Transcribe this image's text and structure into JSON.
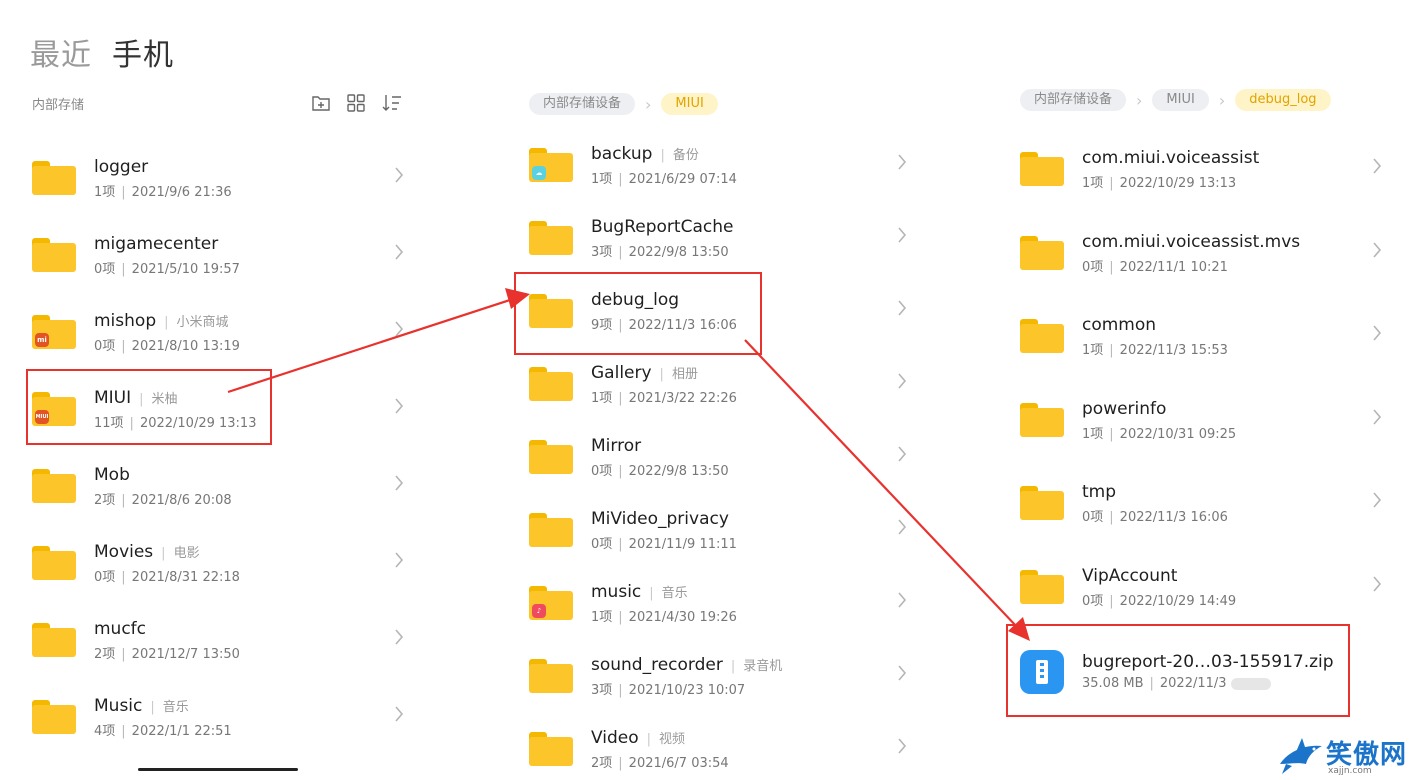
{
  "header": {
    "tab_recent": "最近",
    "tab_phone": "手机"
  },
  "col1": {
    "location": "内部存储",
    "items": [
      {
        "name": "logger",
        "alias": "",
        "count": "1项",
        "date": "2021/9/6 21:36",
        "badge": ""
      },
      {
        "name": "migamecenter",
        "alias": "",
        "count": "0项",
        "date": "2021/5/10 19:57",
        "badge": ""
      },
      {
        "name": "mishop",
        "alias": "小米商城",
        "count": "0项",
        "date": "2021/8/10 13:19",
        "badge": "mi"
      },
      {
        "name": "MIUI",
        "alias": "米柚",
        "count": "11项",
        "date": "2022/10/29 13:13",
        "badge": "MIUI"
      },
      {
        "name": "Mob",
        "alias": "",
        "count": "2项",
        "date": "2021/8/6 20:08",
        "badge": ""
      },
      {
        "name": "Movies",
        "alias": "电影",
        "count": "0项",
        "date": "2021/8/31 22:18",
        "badge": ""
      },
      {
        "name": "mucfc",
        "alias": "",
        "count": "2项",
        "date": "2021/12/7 13:50",
        "badge": ""
      },
      {
        "name": "Music",
        "alias": "音乐",
        "count": "4项",
        "date": "2022/1/1 22:51",
        "badge": ""
      }
    ]
  },
  "col2": {
    "breadcrumb": [
      "内部存储设备",
      "MIUI"
    ],
    "items": [
      {
        "name": "backup",
        "alias": "备份",
        "count": "1项",
        "date": "2021/6/29 07:14",
        "badge": "backup"
      },
      {
        "name": "BugReportCache",
        "alias": "",
        "count": "3项",
        "date": "2022/9/8 13:50",
        "badge": ""
      },
      {
        "name": "debug_log",
        "alias": "",
        "count": "9项",
        "date": "2022/11/3 16:06",
        "badge": ""
      },
      {
        "name": "Gallery",
        "alias": "相册",
        "count": "1项",
        "date": "2021/3/22 22:26",
        "badge": ""
      },
      {
        "name": "Mirror",
        "alias": "",
        "count": "0项",
        "date": "2022/9/8 13:50",
        "badge": ""
      },
      {
        "name": "MiVideo_privacy",
        "alias": "",
        "count": "0项",
        "date": "2021/11/9 11:11",
        "badge": ""
      },
      {
        "name": "music",
        "alias": "音乐",
        "count": "1项",
        "date": "2021/4/30 19:26",
        "badge": "music"
      },
      {
        "name": "sound_recorder",
        "alias": "录音机",
        "count": "3项",
        "date": "2021/10/23 10:07",
        "badge": ""
      },
      {
        "name": "Video",
        "alias": "视频",
        "count": "2项",
        "date": "2021/6/7 03:54",
        "badge": ""
      }
    ]
  },
  "col3": {
    "breadcrumb": [
      "内部存储设备",
      "MIUI",
      "debug_log"
    ],
    "items": [
      {
        "name": "com.miui.voiceassist",
        "count": "1项",
        "date": "2022/10/29 13:13"
      },
      {
        "name": "com.miui.voiceassist.mvs",
        "count": "0项",
        "date": "2022/11/1 10:21"
      },
      {
        "name": "common",
        "count": "1项",
        "date": "2022/11/3 15:53"
      },
      {
        "name": "powerinfo",
        "count": "1项",
        "date": "2022/10/31 09:25"
      },
      {
        "name": "tmp",
        "count": "0项",
        "date": "2022/11/3 16:06"
      },
      {
        "name": "VipAccount",
        "count": "0项",
        "date": "2022/10/29 14:49"
      }
    ],
    "file": {
      "name": "bugreport-20…03-155917.zip",
      "size": "35.08 MB",
      "date": "2022/11/3"
    }
  },
  "watermark": {
    "text": "笑傲网",
    "sub": "xajjn.com"
  },
  "colors": {
    "folder": "#fcc52a",
    "highlight": "#e8322e",
    "crumb_active": "#e0a400",
    "zip": "#2a96f2"
  }
}
